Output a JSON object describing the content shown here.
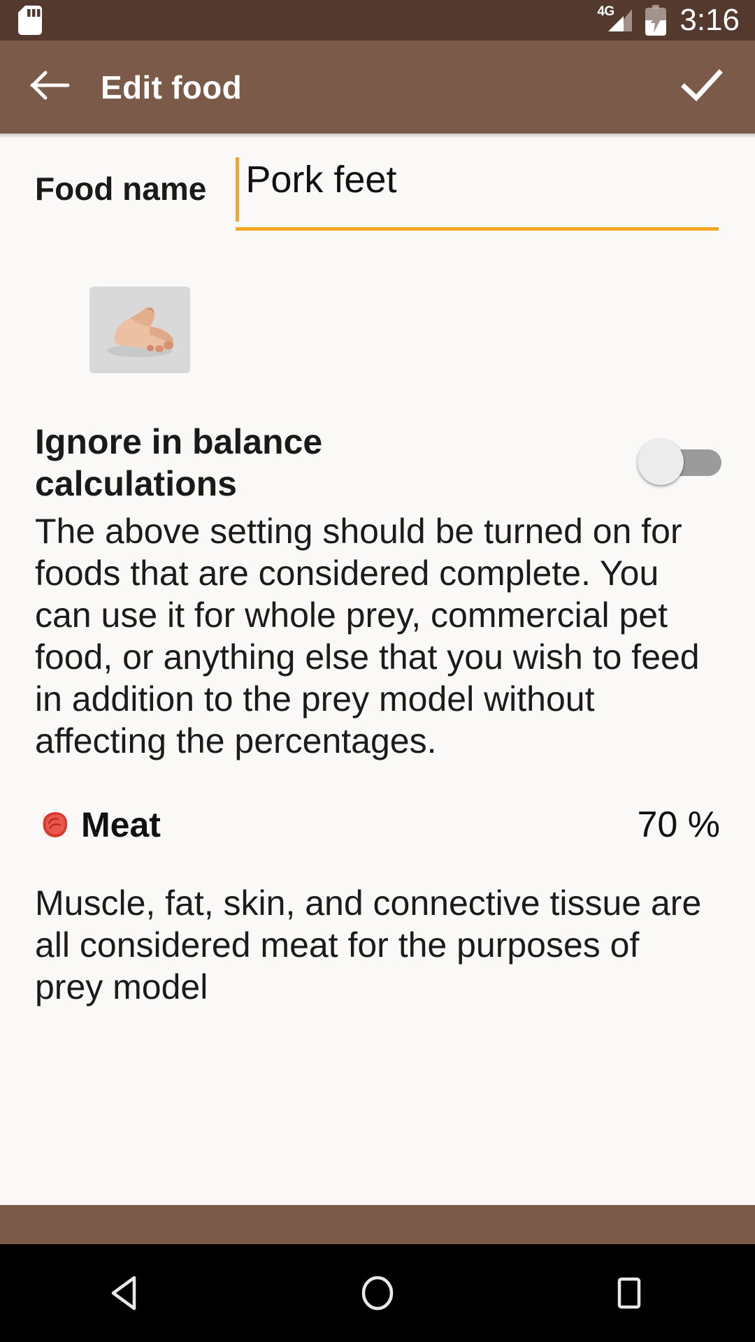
{
  "status_bar": {
    "sd_card_icon": "sd-card-icon",
    "network_type": "4G",
    "signal_icon": "signal-bars-icon",
    "battery_icon": "battery-charging-icon",
    "time": "3:16",
    "background_color": "#54392f"
  },
  "app_bar": {
    "back_icon": "back-arrow-icon",
    "title": "Edit food",
    "confirm_icon": "check-icon",
    "background_color": "#7c5a49"
  },
  "form": {
    "food_name": {
      "label": "Food name",
      "value": "Pork feet",
      "placeholder": "Food name",
      "underline_color": "#f5a623",
      "caret_color": "#f5a623"
    },
    "thumbnail": {
      "name": "food-photo-thumbnail",
      "alt": "Pork feet photo"
    },
    "ignore_setting": {
      "title": "Ignore in balance calculations",
      "toggle_state": "off",
      "toggle_track_color": "#9b9b9b",
      "toggle_thumb_color": "#ececec",
      "description": "The above setting should be turned on for foods that are considered complete. You can use it for whole prey, commercial pet food, or anything else that you wish to feed in addition to the prey model without affecting the percentages."
    }
  },
  "sections": [
    {
      "icon": "meat-cut-icon",
      "label": "Meat",
      "percent": "70 %",
      "description": "Muscle, fat, skin, and connective tissue are all considered meat for the purposes of prey model"
    }
  ],
  "nav_bar": {
    "back_icon": "nav-back-triangle-icon",
    "home_icon": "nav-home-circle-icon",
    "recents_icon": "nav-recents-square-icon",
    "background_color": "#000000"
  }
}
